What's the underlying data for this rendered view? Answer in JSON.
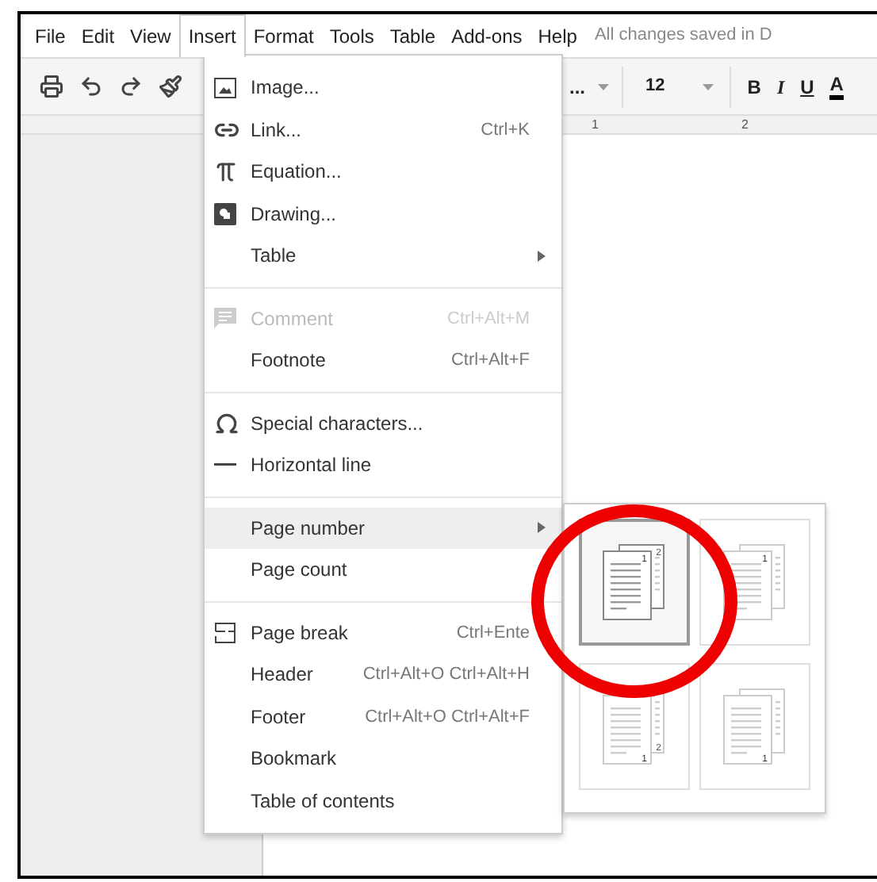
{
  "menubar": {
    "items": [
      {
        "label": "File",
        "selected": false
      },
      {
        "label": "Edit",
        "selected": false
      },
      {
        "label": "View",
        "selected": false
      },
      {
        "label": "Insert",
        "selected": true
      },
      {
        "label": "Format",
        "selected": false
      },
      {
        "label": "Tools",
        "selected": false
      },
      {
        "label": "Table",
        "selected": false
      },
      {
        "label": "Add-ons",
        "selected": false
      },
      {
        "label": "Help",
        "selected": false
      }
    ],
    "status": "All changes saved in D"
  },
  "toolbar": {
    "font_name": "...",
    "font_size": "12",
    "bold": "B",
    "italic": "I",
    "underline": "U",
    "text_color": "A"
  },
  "ruler": {
    "marks": [
      "1",
      "2"
    ]
  },
  "menu": {
    "items": [
      {
        "kind": "item",
        "label": "Image...",
        "selected": false,
        "disabled": false
      },
      {
        "kind": "item",
        "label": "Link...",
        "shortcut": "Ctrl+K",
        "selected": false,
        "disabled": false
      },
      {
        "kind": "item",
        "label": "Equation...",
        "selected": false,
        "disabled": false
      },
      {
        "kind": "item",
        "label": "Drawing...",
        "selected": false,
        "disabled": false
      },
      {
        "kind": "item",
        "label": "Table",
        "submenu": true,
        "selected": false,
        "disabled": false
      },
      {
        "kind": "separator"
      },
      {
        "kind": "item",
        "label": "Comment",
        "shortcut": "Ctrl+Alt+M",
        "selected": false,
        "disabled": true
      },
      {
        "kind": "item",
        "label": "Footnote",
        "shortcut": "Ctrl+Alt+F",
        "selected": false,
        "disabled": false
      },
      {
        "kind": "separator"
      },
      {
        "kind": "item",
        "label": "Special characters...",
        "selected": false,
        "disabled": false
      },
      {
        "kind": "item",
        "label": "Horizontal line",
        "selected": false,
        "disabled": false
      },
      {
        "kind": "separator"
      },
      {
        "kind": "item",
        "label": "Page number",
        "submenu": true,
        "selected": true,
        "disabled": false
      },
      {
        "kind": "item",
        "label": "Page count",
        "selected": false,
        "disabled": false
      },
      {
        "kind": "separator"
      },
      {
        "kind": "item",
        "label": "Page break",
        "shortcut": "Ctrl+Ente",
        "selected": false,
        "disabled": false
      },
      {
        "kind": "item",
        "label": "Header",
        "shortcut": "Ctrl+Alt+O Ctrl+Alt+H",
        "selected": false,
        "disabled": false
      },
      {
        "kind": "item",
        "label": "Footer",
        "shortcut": "Ctrl+Alt+O Ctrl+Alt+F",
        "selected": false,
        "disabled": false
      },
      {
        "kind": "item",
        "label": "Bookmark",
        "selected": false,
        "disabled": false
      },
      {
        "kind": "item",
        "label": "Table of contents",
        "selected": false,
        "disabled": false
      }
    ]
  },
  "page_number_submenu": {
    "tiles": [
      {
        "kind": "header",
        "selected": true,
        "front": "1",
        "back": "2"
      },
      {
        "kind": "header",
        "selected": false,
        "front": "1"
      },
      {
        "kind": "footer",
        "selected": false,
        "front": "1",
        "back": "2"
      },
      {
        "kind": "footer",
        "selected": false,
        "front": "1"
      }
    ]
  }
}
